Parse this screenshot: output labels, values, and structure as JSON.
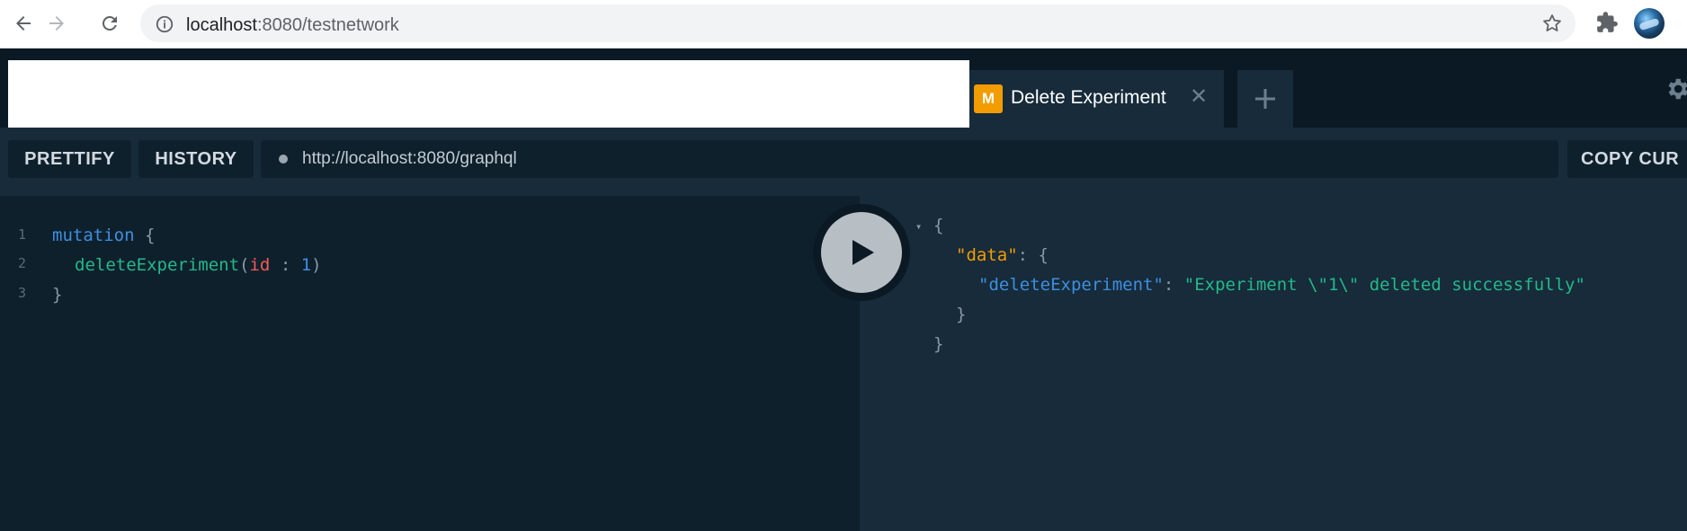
{
  "browser": {
    "url_host": "localhost",
    "url_rest": ":8080/testnetwork"
  },
  "tabs": [
    {
      "badge": "M",
      "title": "Delete Experiment",
      "close": "✕"
    }
  ],
  "new_tab_label": "+",
  "toolbar": {
    "prettify": "PRETTIFY",
    "history": "HISTORY",
    "endpoint": "http://localhost:8080/graphql",
    "copy_curl": "COPY CUR"
  },
  "query": {
    "line_numbers": [
      "1",
      "2",
      "3"
    ],
    "lines": [
      {
        "kw": "mutation",
        "rest": " {"
      },
      {
        "fn": "deleteExperiment",
        "open": "(",
        "arg": "id",
        "sep": " : ",
        "num": "1",
        "close": ")"
      },
      {
        "text": "}"
      }
    ]
  },
  "result": {
    "open": "{",
    "data_key": "\"data\"",
    "colon": ": {",
    "field_key": "\"deleteExperiment\"",
    "field_colon": ": ",
    "field_value": "\"Experiment \\\"1\\\" deleted successfully\"",
    "inner_close": "}",
    "outer_close": "}",
    "collapse_glyph": "▾"
  },
  "colors": {
    "background": "#172b3a",
    "editor": "#0f202d",
    "tabbar": "#0b1924",
    "badge": "#f29c00",
    "keyword": "#3d8fe0",
    "function": "#23b98a",
    "argument": "#f25c54"
  },
  "icons": [
    "back-arrow-icon",
    "forward-arrow-icon",
    "reload-icon",
    "info-icon",
    "star-icon",
    "extensions-icon",
    "gear-icon",
    "play-icon"
  ]
}
